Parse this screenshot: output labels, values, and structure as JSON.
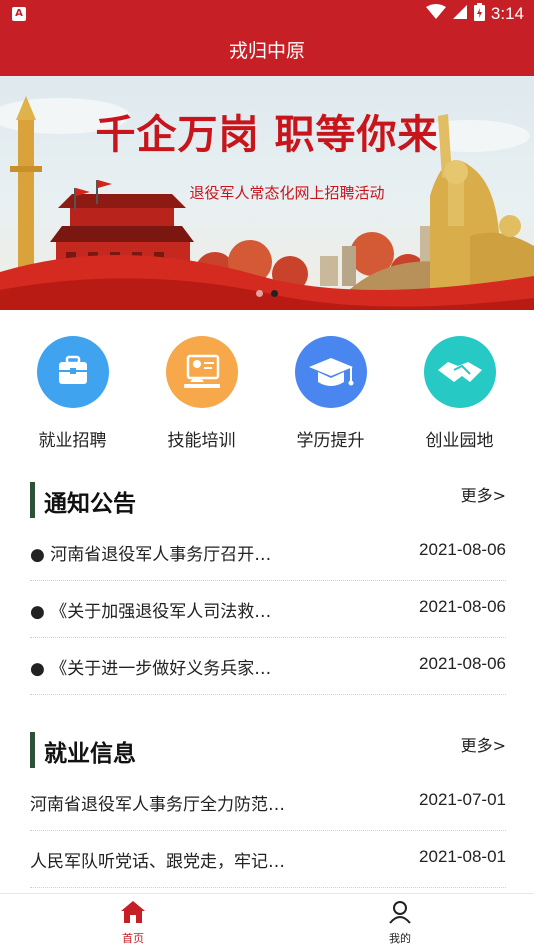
{
  "status_bar": {
    "time": "3:14",
    "app_icon": "A",
    "icons": [
      "wifi-icon",
      "signal-icon",
      "battery-charging-icon"
    ]
  },
  "app_bar": {
    "title": "戎归中原"
  },
  "banner": {
    "headline": "千企万岗  职等你来",
    "subtitle": "退役军人常态化网上招聘活动",
    "page_count": 2,
    "active_page": 2
  },
  "quick_grid": [
    {
      "label": "就业招聘",
      "icon": "briefcase-icon",
      "color": "#3fa3f0"
    },
    {
      "label": "技能培训",
      "icon": "trainer-icon",
      "color": "#f7a84b"
    },
    {
      "label": "学历提升",
      "icon": "graduation-cap-icon",
      "color": "#4a86f0"
    },
    {
      "label": "创业园地",
      "icon": "handshake-icon",
      "color": "#27c9c4"
    }
  ],
  "notices": {
    "title": "通知公告",
    "more": "更多>",
    "items": [
      {
        "title": "● 河南省退役军人事务厅召开…",
        "date": "2021-08-06"
      },
      {
        "title": "● 《关于加强退役军人司法救…",
        "date": "2021-08-06"
      },
      {
        "title": "● 《关于进一步做好义务兵家…",
        "date": "2021-08-06"
      }
    ]
  },
  "jobs": {
    "title": "就业信息",
    "more": "更多>",
    "items": [
      {
        "title": "河南省退役军人事务厅全力防范…",
        "date": "2021-07-01"
      },
      {
        "title": "人民军队听党话、跟党走，牢记…",
        "date": "2021-08-01"
      }
    ]
  },
  "bottom_nav": [
    {
      "label": "首页",
      "icon": "home-icon",
      "active": true
    },
    {
      "label": "我的",
      "icon": "user-icon",
      "active": false
    }
  ],
  "colors": {
    "primary": "#c62026",
    "section_accent": "#2d5236"
  }
}
